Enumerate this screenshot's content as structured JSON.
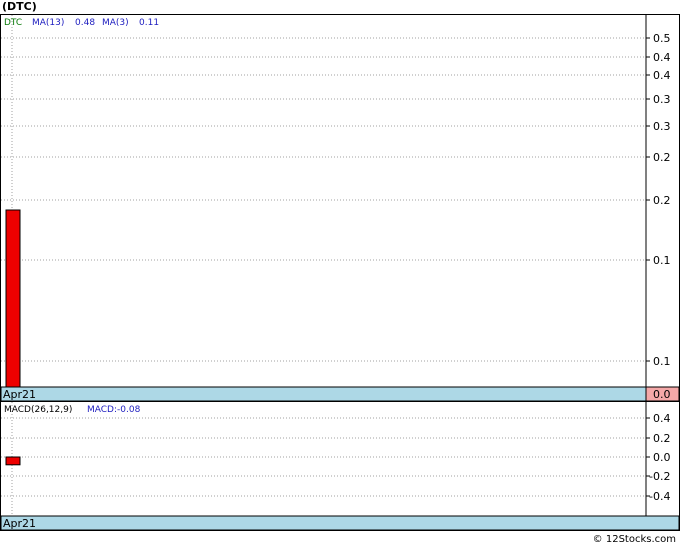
{
  "page": {
    "title": "(DTC)",
    "footer": "© 12Stocks.com"
  },
  "colors": {
    "bar": "#ee0000",
    "grid": "#a0a0a0",
    "date_strip": "#add8e6",
    "last_value_box": "#f4a8a8",
    "legend_symbol": "#0a7a0a",
    "legend_text": "#2020c0"
  },
  "chart_data": [
    {
      "type": "bar",
      "legend": {
        "symbol": "DTC",
        "ma13_label": "MA(13)",
        "ma13_value": "0.48",
        "ma3_label": "MA(3)",
        "ma3_value": "0.11"
      },
      "categories": [
        "Apr21"
      ],
      "x_tick_labels": [
        "Apr21"
      ],
      "y_tick_labels": [
        "0.5",
        "0.4",
        "0.4",
        "0.3",
        "0.3",
        "0.2",
        "0.2",
        "0.1",
        "0.1"
      ],
      "last_value_label": "0.0",
      "series": [
        {
          "values": [
            0.15
          ]
        }
      ],
      "grid": true
    },
    {
      "type": "bar",
      "legend": {
        "label": "MACD(26,12,9)",
        "value_label": "MACD:-0.08"
      },
      "categories": [
        "Apr21"
      ],
      "x_tick_labels": [
        "Apr21"
      ],
      "y_tick_labels": [
        "0.4",
        "0.2",
        "0.0",
        "-0.2",
        "-0.4"
      ],
      "series": [
        {
          "values": [
            -0.08
          ]
        }
      ],
      "grid": true
    }
  ]
}
